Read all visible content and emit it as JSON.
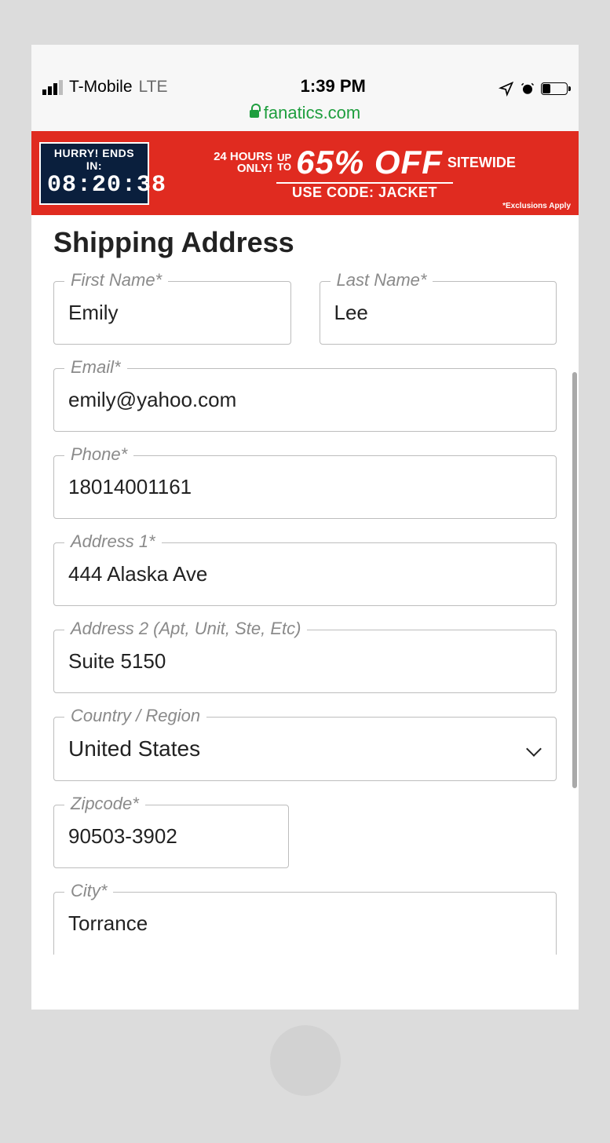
{
  "status": {
    "carrier": "T-Mobile",
    "network": "LTE",
    "time": "1:39 PM",
    "url": "fanatics.com"
  },
  "promo": {
    "hurry": "HURRY! ENDS IN:",
    "timer": "08:20:38",
    "hours_line1": "24 HOURS",
    "hours_line2": "ONLY!",
    "upto_line1": "UP",
    "upto_line2": "TO",
    "percent": "65% OFF",
    "sitewide": "SITEWIDE",
    "usecode": "USE CODE: JACKET",
    "exclusions": "*Exclusions Apply"
  },
  "page": {
    "title": "Shipping Address"
  },
  "form": {
    "first_name": {
      "label": "First Name*",
      "value": "Emily"
    },
    "last_name": {
      "label": "Last Name*",
      "value": "Lee"
    },
    "email": {
      "label": "Email*",
      "value": "emily@yahoo.com"
    },
    "phone": {
      "label": "Phone*",
      "value": "18014001161"
    },
    "address1": {
      "label": "Address 1*",
      "value": "444 Alaska Ave"
    },
    "address2": {
      "label": "Address 2 (Apt, Unit, Ste, Etc)",
      "value": "Suite 5150"
    },
    "country": {
      "label": "Country / Region",
      "value": "United States"
    },
    "zipcode": {
      "label": "Zipcode*",
      "value": "90503-3902"
    },
    "city": {
      "label": "City*",
      "value": "Torrance"
    }
  }
}
